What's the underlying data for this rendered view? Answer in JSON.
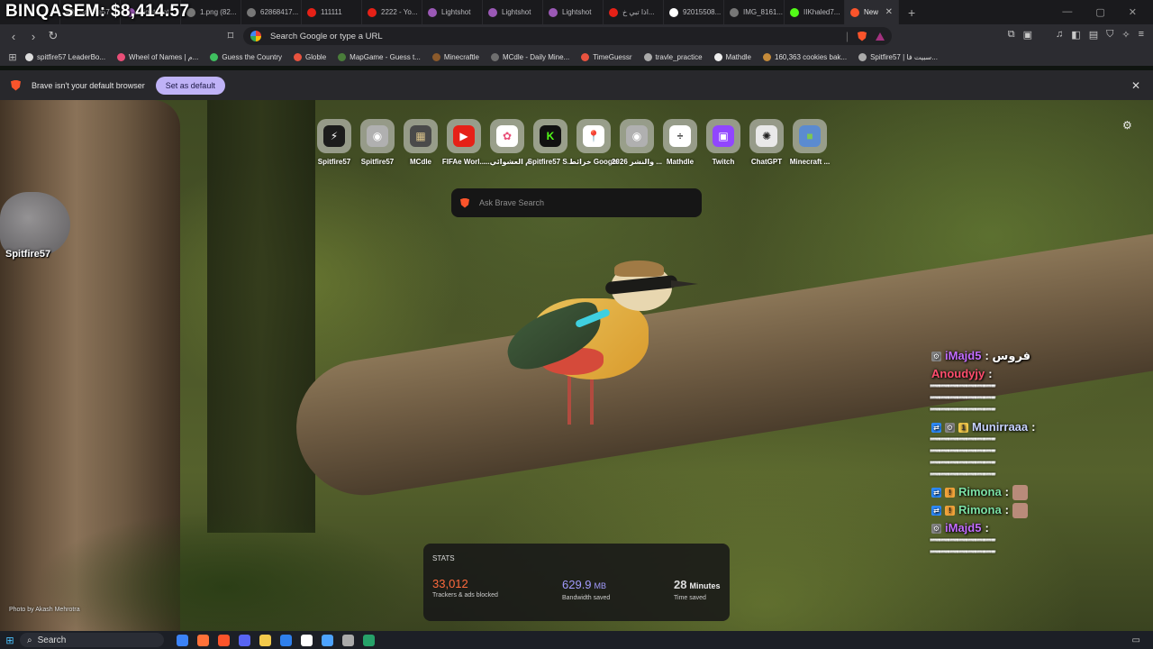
{
  "stream_overlay": {
    "title": "BINQASEM: $8,414.57",
    "streamer_name": "Spitfire57"
  },
  "tabs": [
    {
      "label": "",
      "color": "#2b2b2b"
    },
    {
      "label": "Spitfire57",
      "color": "#777"
    },
    {
      "label": "Lightshot",
      "color": "#9b59b6"
    },
    {
      "label": "1.png (82...",
      "color": "#777"
    },
    {
      "label": "62868417...",
      "color": "#777"
    },
    {
      "label": "111111",
      "color": "#e62117"
    },
    {
      "label": "2222 - Yo...",
      "color": "#e62117"
    },
    {
      "label": "Lightshot",
      "color": "#9b59b6"
    },
    {
      "label": "Lightshot",
      "color": "#9b59b6"
    },
    {
      "label": "Lightshot",
      "color": "#9b59b6"
    },
    {
      "label": "اذا تبي خ...",
      "color": "#e62117"
    },
    {
      "label": "92015508...",
      "color": "#ffffff"
    },
    {
      "label": "IMG_8161...",
      "color": "#777"
    },
    {
      "label": "IIKhaled7...",
      "color": "#53fc18"
    },
    {
      "label": "New",
      "color": "#fb542b",
      "active": true
    }
  ],
  "omnibox": {
    "placeholder": "Search Google or type a URL"
  },
  "bookmarks": [
    {
      "label": "spitfire57 LeaderBo...",
      "color": "#dddddd"
    },
    {
      "label": "Wheel of Names | م...",
      "color": "#e94e77"
    },
    {
      "label": "Guess the Country",
      "color": "#3fbf5f"
    },
    {
      "label": "Globle",
      "color": "#e8533f"
    },
    {
      "label": "MapGame - Guess t...",
      "color": "#4a7d3a"
    },
    {
      "label": "Minecraftle",
      "color": "#8b5a2b"
    },
    {
      "label": "MCdle - Daily Mine...",
      "color": "#6f6f6f"
    },
    {
      "label": "TimeGuessr",
      "color": "#e8533f"
    },
    {
      "label": "travle_practice",
      "color": "#aaaaaa"
    },
    {
      "label": "Mathdle",
      "color": "#eeeeee"
    },
    {
      "label": "160,363 cookies bak...",
      "color": "#c58b3a"
    },
    {
      "label": "Spitfire57 | سبيت فا...",
      "color": "#aaaaaa"
    }
  ],
  "infobar": {
    "message": "Brave isn't your default browser",
    "button": "Set as default"
  },
  "top_sites": [
    {
      "label": "Spitfire57",
      "glyph": "⚡",
      "bg": "#1c1c1c",
      "fg": "#ffffff"
    },
    {
      "label": "Spitfire57",
      "glyph": "◉",
      "bg": "#b0b0b0",
      "fg": "#ffffff"
    },
    {
      "label": "MCdle",
      "glyph": "▦",
      "bg": "#4a4a4a",
      "fg": "#d9c28a"
    },
    {
      "label": "FIFAe Worl...",
      "glyph": "▶",
      "bg": "#e62117",
      "fg": "#ffffff"
    },
    {
      "label": "...م العشوائي",
      "glyph": "✿",
      "bg": "#ffffff",
      "fg": "#e94e77"
    },
    {
      "label": "Spitfire57 S...",
      "glyph": "K",
      "bg": "#111111",
      "fg": "#53fc18"
    },
    {
      "label": "خرائط Google",
      "glyph": "📍",
      "bg": "#ffffff",
      "fg": "#34a853"
    },
    {
      "label": "2026 والنشر ...",
      "glyph": "◉",
      "bg": "#b0b0b0",
      "fg": "#ffffff"
    },
    {
      "label": "Mathdle",
      "glyph": "÷",
      "bg": "#ffffff",
      "fg": "#333333"
    },
    {
      "label": "Twitch",
      "glyph": "▣",
      "bg": "#9146ff",
      "fg": "#ffffff"
    },
    {
      "label": "ChatGPT",
      "glyph": "✺",
      "bg": "#e9e9e9",
      "fg": "#222222"
    },
    {
      "label": "Minecraft ...",
      "glyph": "■",
      "bg": "#5b8bd0",
      "fg": "#7ec850"
    }
  ],
  "ntp_search": {
    "placeholder": "Ask Brave Search"
  },
  "stats": {
    "title": "STATS",
    "trackers": {
      "value": "33,012",
      "desc": "Trackers & ads blocked",
      "color": "#ff6a3d"
    },
    "bandwidth": {
      "value": "629.9",
      "unit": "MB",
      "desc": "Bandwidth saved",
      "color": "#a29bfe"
    },
    "time": {
      "value": "28",
      "unit": "Minutes",
      "desc": "Time saved",
      "color": "#ffffff"
    }
  },
  "photo_credit": "Photo by Akash Mehrotra",
  "chat": [
    {
      "user": "iMajd5",
      "user_color": "#c26cff",
      "inline_text": ": فروس",
      "badges": [
        "gear"
      ],
      "message": ""
    },
    {
      "user": "Anoudyjy",
      "user_color": "#ff4d6d",
      "inline_text": ":",
      "badges": [],
      "message": "ꞌꞌꞌꞌꞌꞌꞌꞌꞌꞌꞌꞌꞌꞌꞌꞌꞌꞌꞌꞌꞌꞌꞌꞌꞌꞌꞌꞌꞌꞌꞌꞌꞌꞌꞌꞌꞌꞌꞌꞌꞌꞌꞌꞌꞌꞌꞌꞌꞌꞌꞌꞌꞌꞌꞌꞌꞌꞌꞌꞌꞌꞌꞌꞌꞌꞌꞌꞌꞌꞌꞌꞌꞌꞌꞌꞌꞌꞌꞌꞌ",
      "lines": 3
    },
    {
      "user": "Munirraaa",
      "user_color": "#c7d2ff",
      "inline_text": ":",
      "badges": [
        "share",
        "gear",
        "coin"
      ],
      "message": "ꞌꞌꞌꞌꞌꞌꞌꞌꞌꞌꞌꞌꞌꞌꞌꞌꞌꞌꞌꞌꞌꞌꞌꞌꞌꞌꞌꞌꞌꞌꞌꞌꞌꞌꞌꞌꞌꞌꞌꞌꞌꞌꞌꞌꞌꞌꞌꞌꞌꞌꞌꞌꞌꞌꞌꞌꞌꞌꞌꞌꞌꞌꞌꞌꞌꞌꞌꞌꞌꞌꞌꞌꞌꞌꞌꞌꞌꞌꞌꞌ",
      "lines": 4
    },
    {
      "user": "Rimona",
      "user_color": "#7be0a5",
      "inline_text": ":",
      "badges": [
        "share",
        "bang"
      ],
      "message": "",
      "thumb": true
    },
    {
      "user": "Rimona",
      "user_color": "#7be0a5",
      "inline_text": ":",
      "badges": [
        "share",
        "bang"
      ],
      "message": "",
      "thumb": true
    },
    {
      "user": "iMajd5",
      "user_color": "#c26cff",
      "inline_text": ":",
      "badges": [
        "gear"
      ],
      "message": "ꞌꞌꞌꞌꞌꞌꞌꞌꞌꞌꞌꞌꞌꞌꞌꞌꞌꞌꞌꞌꞌꞌꞌꞌꞌꞌꞌꞌꞌꞌꞌꞌꞌꞌꞌꞌꞌꞌꞌꞌꞌꞌꞌꞌꞌꞌꞌꞌꞌꞌꞌꞌꞌꞌꞌꞌꞌꞌꞌꞌꞌꞌꞌꞌꞌꞌꞌꞌꞌꞌꞌꞌꞌꞌꞌꞌꞌꞌꞌꞌ",
      "lines": 2
    }
  ],
  "taskbar": {
    "search_label": "Search",
    "apps": [
      "#3b82f6",
      "#ff7139",
      "#fb542b",
      "#5865f2",
      "#f2c94c",
      "#2f80ed",
      "#ffffff",
      "#4da3ff",
      "#aaaaaa",
      "#26a269"
    ]
  }
}
